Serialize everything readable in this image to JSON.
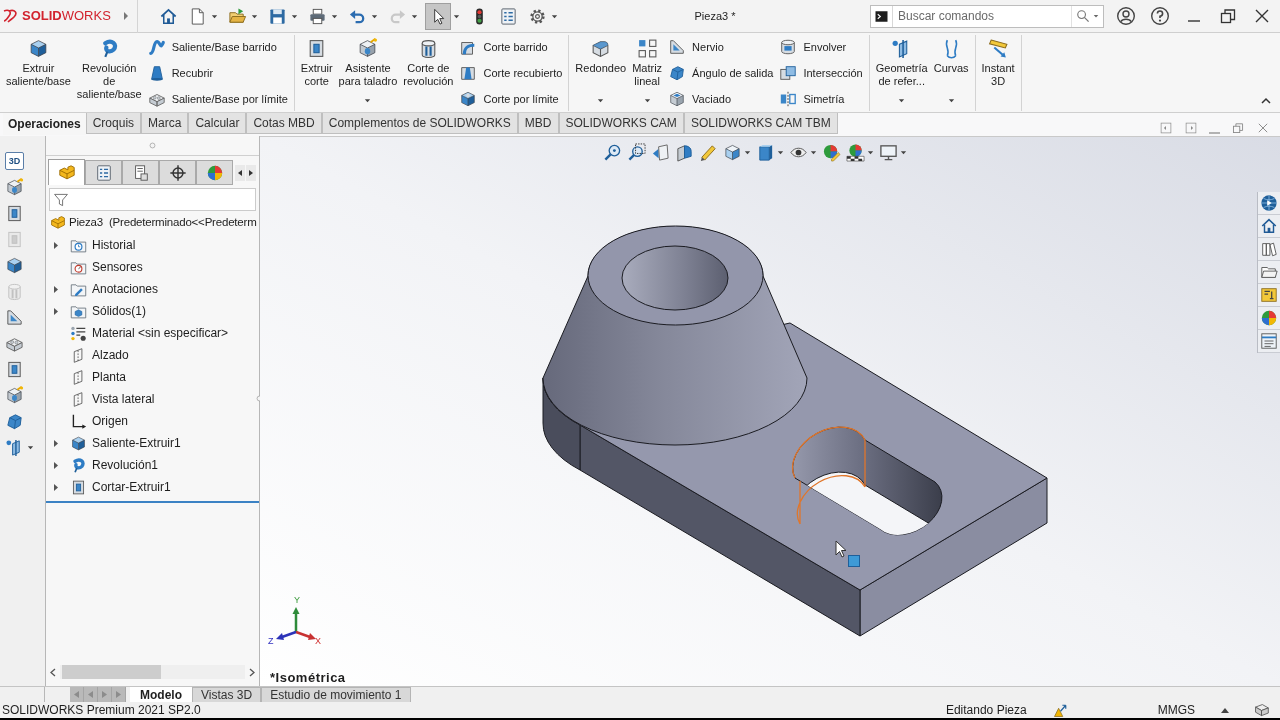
{
  "title_bar": {
    "logo": "**SOLID**WORKS",
    "document_title": "Pieza3 *",
    "search": {
      "placeholder": "Buscar comandos"
    }
  },
  "quick_access": [
    {
      "dropdown": false,
      "disabled": false,
      "selected": false
    },
    {
      "dropdown": true,
      "disabled": false,
      "selected": false
    },
    {
      "dropdown": true,
      "disabled": false,
      "selected": false
    },
    {
      "dropdown": true,
      "disabled": false,
      "selected": false
    },
    {
      "dropdown": true,
      "disabled": false,
      "selected": false
    },
    {
      "dropdown": true,
      "disabled": false,
      "selected": false
    },
    {
      "dropdown": true,
      "disabled": true,
      "selected": false
    },
    {
      "dropdown": true,
      "disabled": false,
      "selected": true
    },
    {
      "dropdown": false,
      "disabled": false,
      "selected": false
    },
    {
      "dropdown": false,
      "disabled": false,
      "selected": false
    },
    {
      "dropdown": true,
      "disabled": false,
      "selected": false
    }
  ],
  "ribbon": {
    "groups": [
      {
        "items": [
          {
            "kind": "large",
            "label": "Extruir\nsaliente/base",
            "dropdown": false
          },
          {
            "kind": "large",
            "label": "Revolución\nde\nsaliente/base",
            "dropdown": false
          },
          {
            "kind": "stack",
            "buttons": [
              "Saliente/Base barrido",
              "Recubrir",
              "Saliente/Base por límite"
            ]
          }
        ]
      },
      {
        "items": [
          {
            "kind": "large",
            "label": "Extruir\ncorte",
            "dropdown": false
          },
          {
            "kind": "large",
            "label": "Asistente\npara taladro",
            "dropdown": true
          },
          {
            "kind": "large",
            "label": "Corte de\nrevolución",
            "dropdown": false
          },
          {
            "kind": "stack",
            "buttons": [
              "Corte barrido",
              "Corte recubierto",
              "Corte por límite"
            ]
          }
        ]
      },
      {
        "items": [
          {
            "kind": "large",
            "label": "Redondeo",
            "dropdown": true
          },
          {
            "kind": "large",
            "label": "Matriz\nlineal",
            "dropdown": true
          },
          {
            "kind": "stack",
            "buttons": [
              "Nervio",
              "Ángulo de salida",
              "Vaciado"
            ]
          },
          {
            "kind": "stack",
            "buttons": [
              "Envolver",
              "Intersección",
              "Simetría"
            ]
          }
        ]
      },
      {
        "items": [
          {
            "kind": "large",
            "label": "Geometría\nde refer...",
            "dropdown": true
          },
          {
            "kind": "large",
            "label": "Curvas",
            "dropdown": true
          }
        ]
      },
      {
        "items": [
          {
            "kind": "large",
            "label": "Instant\n3D",
            "dropdown": false
          }
        ]
      }
    ]
  },
  "command_tabs": [
    {
      "label": "Operaciones",
      "selected": true
    },
    {
      "label": "Croquis",
      "selected": false
    },
    {
      "label": "Marca",
      "selected": false
    },
    {
      "label": "Calcular",
      "selected": false
    },
    {
      "label": "Cotas MBD",
      "selected": false
    },
    {
      "label": "Complementos de SOLIDWORKS",
      "selected": false
    },
    {
      "label": "MBD",
      "selected": false
    },
    {
      "label": "SOLIDWORKS CAM",
      "selected": false
    },
    {
      "label": "SOLIDWORKS CAM TBM",
      "selected": false
    }
  ],
  "shortcut_bar": [
    {
      "label": "3D",
      "disabled": false,
      "dropdown": false
    },
    {
      "disabled": false,
      "dropdown": false
    },
    {
      "disabled": false,
      "dropdown": false
    },
    {
      "disabled": true,
      "dropdown": false
    },
    {
      "disabled": false,
      "dropdown": false
    },
    {
      "disabled": true,
      "dropdown": false
    },
    {
      "disabled": false,
      "dropdown": false
    },
    {
      "disabled": false,
      "dropdown": false
    },
    {
      "disabled": false,
      "dropdown": false
    },
    {
      "disabled": false,
      "dropdown": false
    },
    {
      "disabled": false,
      "dropdown": false
    },
    {
      "disabled": false,
      "dropdown": true
    }
  ],
  "feature_tree": {
    "tabs": [
      {
        "selected": true
      },
      {
        "selected": false
      },
      {
        "selected": false
      },
      {
        "selected": false
      },
      {
        "selected": false
      }
    ],
    "root": {
      "label": "Pieza3  (Predeterminado<<Predeterm",
      "children": [
        {
          "label": "Historial",
          "expandable": true
        },
        {
          "label": "Sensores",
          "expandable": false
        },
        {
          "label": "Anotaciones",
          "expandable": true
        },
        {
          "label": "Sólidos(1)",
          "expandable": true
        },
        {
          "label": "Material <sin especificar>",
          "expandable": false
        },
        {
          "label": "Alzado",
          "expandable": false
        },
        {
          "label": "Planta",
          "expandable": false
        },
        {
          "label": "Vista lateral",
          "expandable": false
        },
        {
          "label": "Origen",
          "expandable": false
        },
        {
          "label": "Saliente-Extruir1",
          "expandable": true
        },
        {
          "label": "Revolución1",
          "expandable": true
        },
        {
          "label": "Cortar-Extruir1",
          "expandable": true
        }
      ]
    }
  },
  "viewport": {
    "view_name": "*Isométrica",
    "triad_labels": [
      "Y",
      "X",
      "Z"
    ]
  },
  "bottom_tabs": [
    {
      "label": "Modelo",
      "selected": true
    },
    {
      "label": "Vistas 3D",
      "selected": false
    },
    {
      "label": "Estudio de movimiento 1",
      "selected": false
    }
  ],
  "status_bar": {
    "product": "SOLIDWORKS Premium 2021 SP2.0",
    "mode": "Editando Pieza",
    "units": "MMGS"
  }
}
